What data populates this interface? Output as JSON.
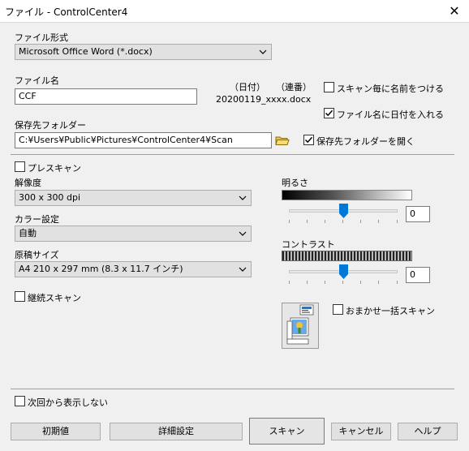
{
  "window": {
    "title": "ファイル - ControlCenter4",
    "close": "✕"
  },
  "file_format": {
    "label": "ファイル形式",
    "value": "Microsoft Office Word (*.docx)"
  },
  "file_name": {
    "label": "ファイル名",
    "value": "CCF",
    "date_label": "（日付）",
    "serial_label": "（連番）",
    "preview": "20200119_xxxx.docx"
  },
  "options": {
    "name_each_scan": {
      "label": "スキャン毎に名前をつける",
      "checked": false
    },
    "add_date": {
      "label": "ファイル名に日付を入れる",
      "checked": true
    }
  },
  "save_folder": {
    "label": "保存先フォルダー",
    "value": "C:¥Users¥Public¥Pictures¥ControlCenter4¥Scan",
    "open_folder": {
      "label": "保存先フォルダーを開く",
      "checked": true
    }
  },
  "prescan": {
    "label": "プレスキャン",
    "checked": false
  },
  "resolution": {
    "label": "解像度",
    "value": "300 x 300 dpi"
  },
  "color": {
    "label": "カラー設定",
    "value": "自動"
  },
  "doc_size": {
    "label": "原稿サイズ",
    "value": "A4 210 x 297 mm (8.3 x 11.7 インチ)"
  },
  "continuous": {
    "label": "継続スキャン",
    "checked": false
  },
  "brightness": {
    "label": "明るさ",
    "value": "0",
    "level": 0.5
  },
  "contrast": {
    "label": "コントラスト",
    "value": "0",
    "level": 0.5
  },
  "auto_crop": {
    "label": "おまかせ一括スキャン",
    "checked": false
  },
  "dont_show": {
    "label": "次回から表示しない",
    "checked": false
  },
  "buttons": {
    "default": "初期値",
    "advanced": "詳細設定",
    "scan": "スキャン",
    "cancel": "キャンセル",
    "help": "ヘルプ"
  },
  "colors": {
    "accent": "#0078d7",
    "window_bg": "#f0f0f0"
  }
}
